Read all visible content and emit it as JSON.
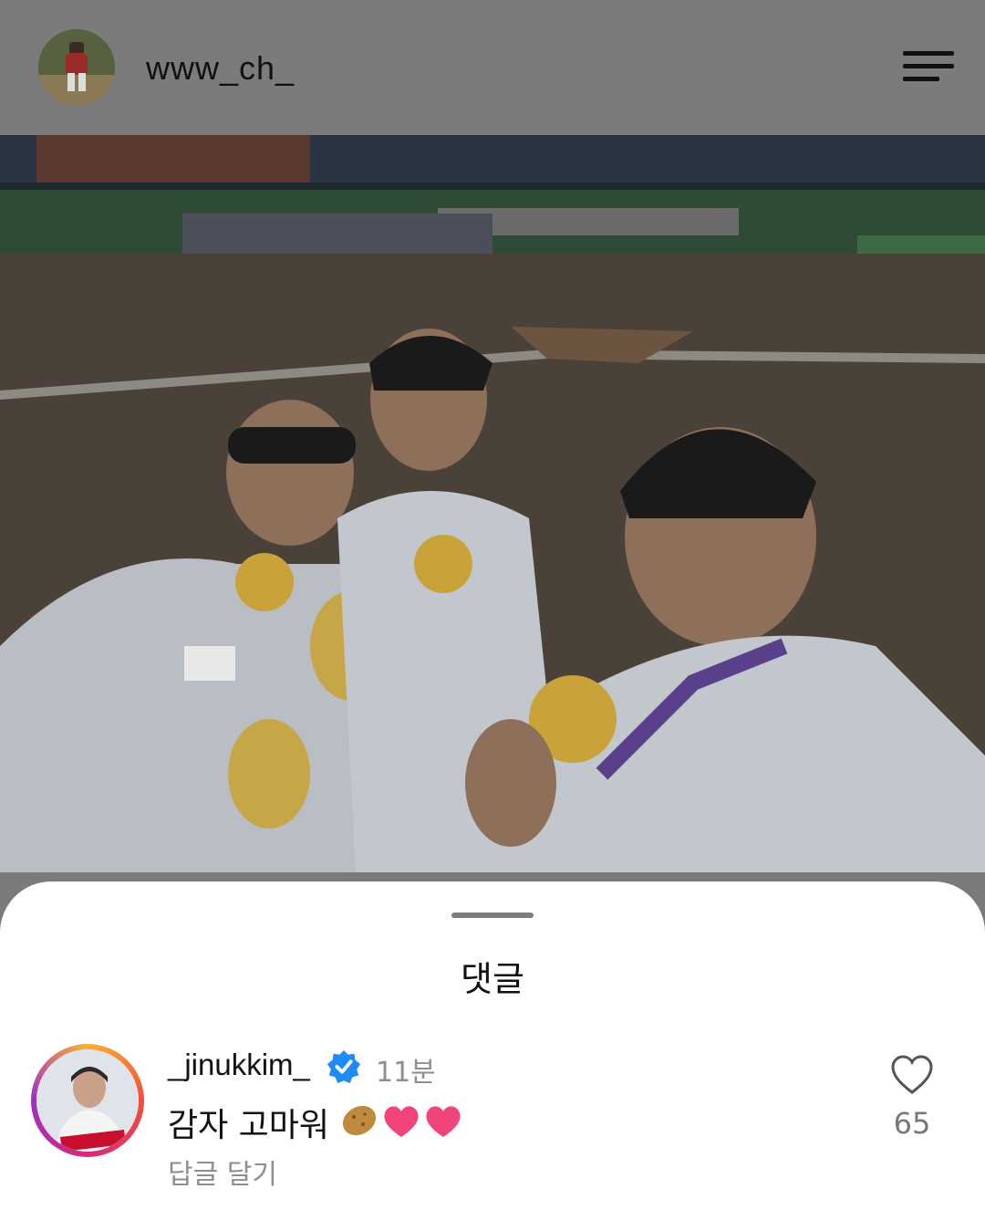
{
  "header": {
    "username": "www_ch_",
    "avatar_icon": "profile-photo",
    "menu_icon": "menu-icon"
  },
  "post": {
    "image": "photo-three-players-with-gold-medals"
  },
  "comments_sheet": {
    "title": "댓글",
    "comments": [
      {
        "username": "_jinukkim_",
        "verified": true,
        "time": "11분",
        "text": "감자 고마워",
        "emojis": [
          "potato",
          "heart",
          "heart"
        ],
        "reply_label": "답글 달기",
        "likes": "65"
      }
    ]
  },
  "colors": {
    "overlay": "#7b7b7b",
    "verified_blue": "#1f8cf5",
    "muted_text": "#8e8e8e"
  }
}
